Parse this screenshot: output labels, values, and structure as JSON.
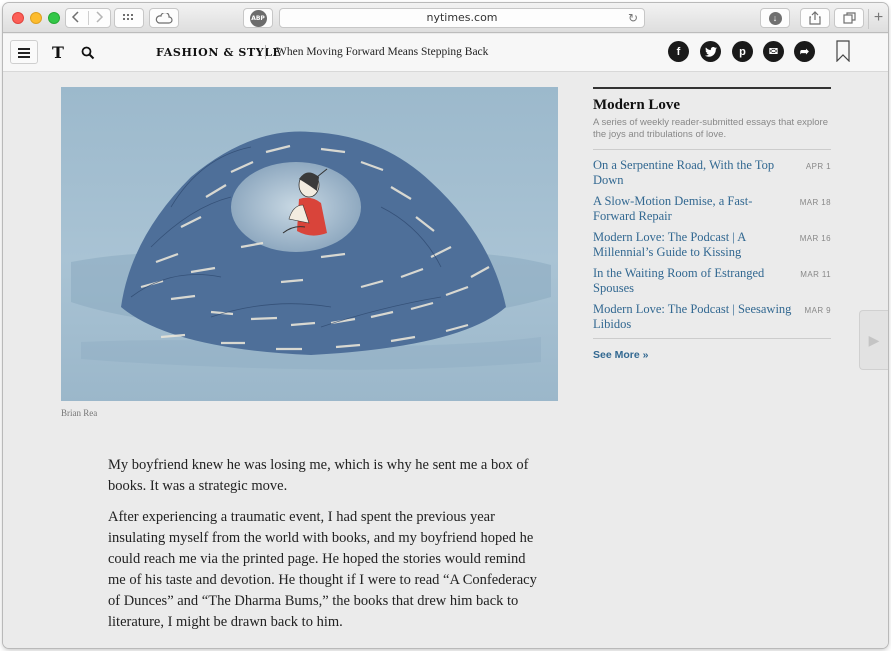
{
  "browser": {
    "url": "nytimes.com",
    "adblock_label": "ABP",
    "new_tab_label": "+"
  },
  "header": {
    "logo": "T",
    "section": "FASHION & STYLE",
    "headline": "When Moving Forward Means Stepping Back",
    "social": {
      "facebook": "f",
      "twitter": "t",
      "pinterest": "p",
      "email": "✉",
      "share": "➦"
    }
  },
  "image": {
    "credit": "Brian Rea"
  },
  "article": {
    "paragraphs": [
      "My boyfriend knew he was losing me, which is why he sent me a box of books. It was a strategic move.",
      "After experiencing a traumatic event, I had spent the previous year insulating myself from the world with books, and my boyfriend hoped he could reach me via the printed page. He hoped the stories would remind me of his taste and devotion. He thought if I were to read “A Confederacy of Dunces” and “The Dharma Bums,” the books that drew him back to literature, I might be drawn back to him."
    ]
  },
  "sidebar": {
    "title": "Modern Love",
    "description": "A series of weekly reader-submitted essays that explore the joys and tribulations of love.",
    "items": [
      {
        "title": "On a Serpentine Road, With the Top Down",
        "date": "APR 1"
      },
      {
        "title": "A Slow-Motion Demise, a Fast-Forward Repair",
        "date": "MAR 18"
      },
      {
        "title": "Modern Love: The Podcast | A Millennial’s Guide to Kissing",
        "date": "MAR 16"
      },
      {
        "title": "In the Waiting Room of Estranged Spouses",
        "date": "MAR 11"
      },
      {
        "title": "Modern Love: The Podcast | Seesawing Libidos",
        "date": "MAR 9"
      }
    ],
    "see_more": "See More »"
  },
  "colors": {
    "link": "#326891",
    "illustration_bg": "#a9c3d4",
    "books": "#4e6f99"
  }
}
